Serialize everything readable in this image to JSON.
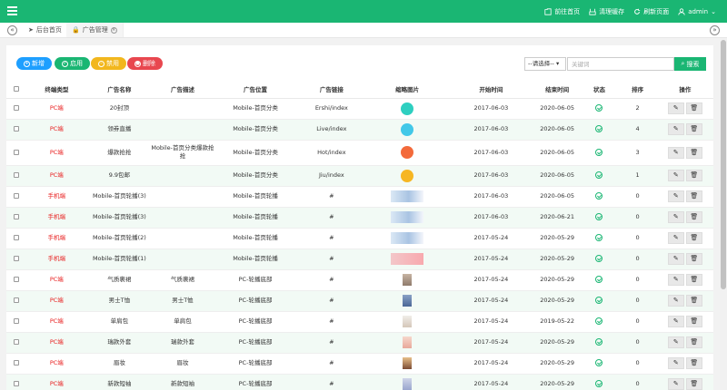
{
  "top": {
    "links": [
      {
        "icon": "home-icon",
        "label": "前往首页"
      },
      {
        "icon": "broom-icon",
        "label": "清理缓存"
      },
      {
        "icon": "refresh-icon",
        "label": "刷新页面"
      },
      {
        "icon": "user-icon",
        "label": "admin"
      }
    ]
  },
  "tabs": {
    "items": [
      {
        "icon": "send-icon",
        "label": "后台首页"
      },
      {
        "icon": "lock-icon",
        "label": "广告管理"
      }
    ]
  },
  "toolbar": {
    "add_label": "新增",
    "enable_label": "启用",
    "disable_label": "禁用",
    "delete_label": "删除",
    "select_value": "--请选择--",
    "search_placeholder": "关键词",
    "search_label": "搜索"
  },
  "colors": {
    "accent": "#1ab673",
    "add": "#1e9fff",
    "enable": "#1ab673",
    "disable": "#f2b71e",
    "delete": "#e8474f",
    "red_text": "#e81e1e"
  },
  "table": {
    "headers": [
      "终端类型",
      "广告名称",
      "广告描述",
      "广告位置",
      "广告链接",
      "缩略图片",
      "开始时间",
      "结束时间",
      "状态",
      "排序",
      "操作"
    ],
    "rows": [
      {
        "type": "PC端",
        "name": "20封顶",
        "desc": "",
        "position": "Mobile-首页分类",
        "link": "Ershi/index",
        "image": "gamepad-icon",
        "start": "2017-06-03",
        "end": "2020-06-05",
        "sort": "2"
      },
      {
        "type": "PC端",
        "name": "领券直播",
        "desc": "",
        "position": "Mobile-首页分类",
        "link": "Live/index",
        "image": "tv-icon",
        "start": "2017-06-03",
        "end": "2020-06-05",
        "sort": "4"
      },
      {
        "type": "PC端",
        "name": "爆款抢抢",
        "desc": "Mobile-首页分类爆款抢抢",
        "position": "Mobile-首页分类",
        "link": "Hot/index",
        "image": "fire-icon",
        "start": "2017-06-03",
        "end": "2020-06-05",
        "sort": "3"
      },
      {
        "type": "PC端",
        "name": "9.9包邮",
        "desc": "",
        "position": "Mobile-首页分类",
        "link": "Jiu/index",
        "image": "bag-icon",
        "start": "2017-06-03",
        "end": "2020-06-05",
        "sort": "1"
      },
      {
        "type": "手机端",
        "name": "Mobile-首页轮播(3)",
        "desc": "",
        "position": "Mobile-首页轮播",
        "link": "#",
        "image": "banner-image",
        "start": "2017-06-03",
        "end": "2020-06-05",
        "sort": "0"
      },
      {
        "type": "手机端",
        "name": "Mobile-首页轮播(3)",
        "desc": "",
        "position": "Mobile-首页轮播",
        "link": "#",
        "image": "banner-image",
        "start": "2017-06-03",
        "end": "2020-06-21",
        "sort": "0"
      },
      {
        "type": "手机端",
        "name": "Mobile-首页轮播(2)",
        "desc": "",
        "position": "Mobile-首页轮播",
        "link": "#",
        "image": "banner-image",
        "start": "2017-05-24",
        "end": "2020-05-29",
        "sort": "0"
      },
      {
        "type": "手机端",
        "name": "Mobile-首页轮播(1)",
        "desc": "",
        "position": "Mobile-首页轮播",
        "link": "#",
        "image": "banner-pink-image",
        "start": "2017-05-24",
        "end": "2020-05-29",
        "sort": "0"
      },
      {
        "type": "PC端",
        "name": "气质裹裙",
        "desc": "气质裹裙",
        "position": "PC-轮播底部",
        "link": "#",
        "image": "skirt-image",
        "start": "2017-05-24",
        "end": "2020-05-29",
        "sort": "0"
      },
      {
        "type": "PC端",
        "name": "男士T恤",
        "desc": "男士T恤",
        "position": "PC-轮播底部",
        "link": "#",
        "image": "tshirt-image",
        "start": "2017-05-24",
        "end": "2020-05-29",
        "sort": "0"
      },
      {
        "type": "PC端",
        "name": "单肩包",
        "desc": "单肩包",
        "position": "PC-轮播底部",
        "link": "#",
        "image": "handbag-image",
        "start": "2017-05-24",
        "end": "2019-05-22",
        "sort": "0"
      },
      {
        "type": "PC端",
        "name": "瑞款外套",
        "desc": "瑞款外套",
        "position": "PC-轮播底部",
        "link": "#",
        "image": "coat-image",
        "start": "2017-05-24",
        "end": "2020-05-29",
        "sort": "0"
      },
      {
        "type": "PC端",
        "name": "眉妆",
        "desc": "眉妆",
        "position": "PC-轮播底部",
        "link": "#",
        "image": "cosmetic-image",
        "start": "2017-05-24",
        "end": "2020-05-29",
        "sort": "0"
      },
      {
        "type": "PC端",
        "name": "新款短袖",
        "desc": "新款短袖",
        "position": "PC-轮播底部",
        "link": "#",
        "image": "shirt-image",
        "start": "2017-05-24",
        "end": "2020-05-29",
        "sort": "0"
      }
    ]
  }
}
